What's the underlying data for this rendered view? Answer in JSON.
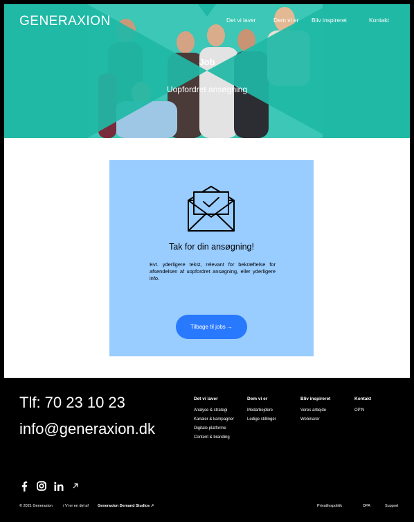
{
  "header": {
    "logo": "GENERAXION",
    "nav": [
      "Det vi laver",
      "Dem vi er",
      "Bliv inspireret",
      "Kontakt"
    ]
  },
  "hero": {
    "title": "Job",
    "subtitle": "Uopfordret ansøgning"
  },
  "confirmation": {
    "icon": "envelope-check-icon",
    "title": "Tak for din ansøgning!",
    "text": "Evt. yderligere tekst, relevant for bekræftelse for afsendelsen af uopfordret ansøgning, eller yderligere info.",
    "button_label": "Tilbage til jobs →"
  },
  "footer": {
    "phone": "Tlf: 70 23 10 23",
    "email": "info@generaxion.dk",
    "columns": [
      {
        "heading": "Det vi laver",
        "links": [
          "Analyse & strategi",
          "Kanaler & kampagner",
          "Digitale platforme",
          "Content & branding"
        ]
      },
      {
        "heading": "Dem vi er",
        "links": [
          "Medarbejdere",
          "Ledige stillinger"
        ]
      },
      {
        "heading": "Bliv inspireret",
        "links": [
          "Vores arbejde",
          "Webinarer"
        ]
      },
      {
        "heading": "Kontakt",
        "links": [
          "OP'N"
        ]
      }
    ],
    "social": [
      "facebook-icon",
      "instagram-icon",
      "linkedin-icon",
      "external-arrow-icon"
    ],
    "copyright": "© 2021 Generaxion",
    "parent_prefix": "/ Vi er en del af",
    "parent_name": "Generaxion Demand Studios ↗",
    "legal": [
      "Privatlivspolitik",
      "DPA",
      "Support"
    ]
  },
  "colors": {
    "hero_teal": "#1fb8a6",
    "card_blue": "#99ccff",
    "button_blue": "#2979ff",
    "footer_bg": "#000000"
  }
}
